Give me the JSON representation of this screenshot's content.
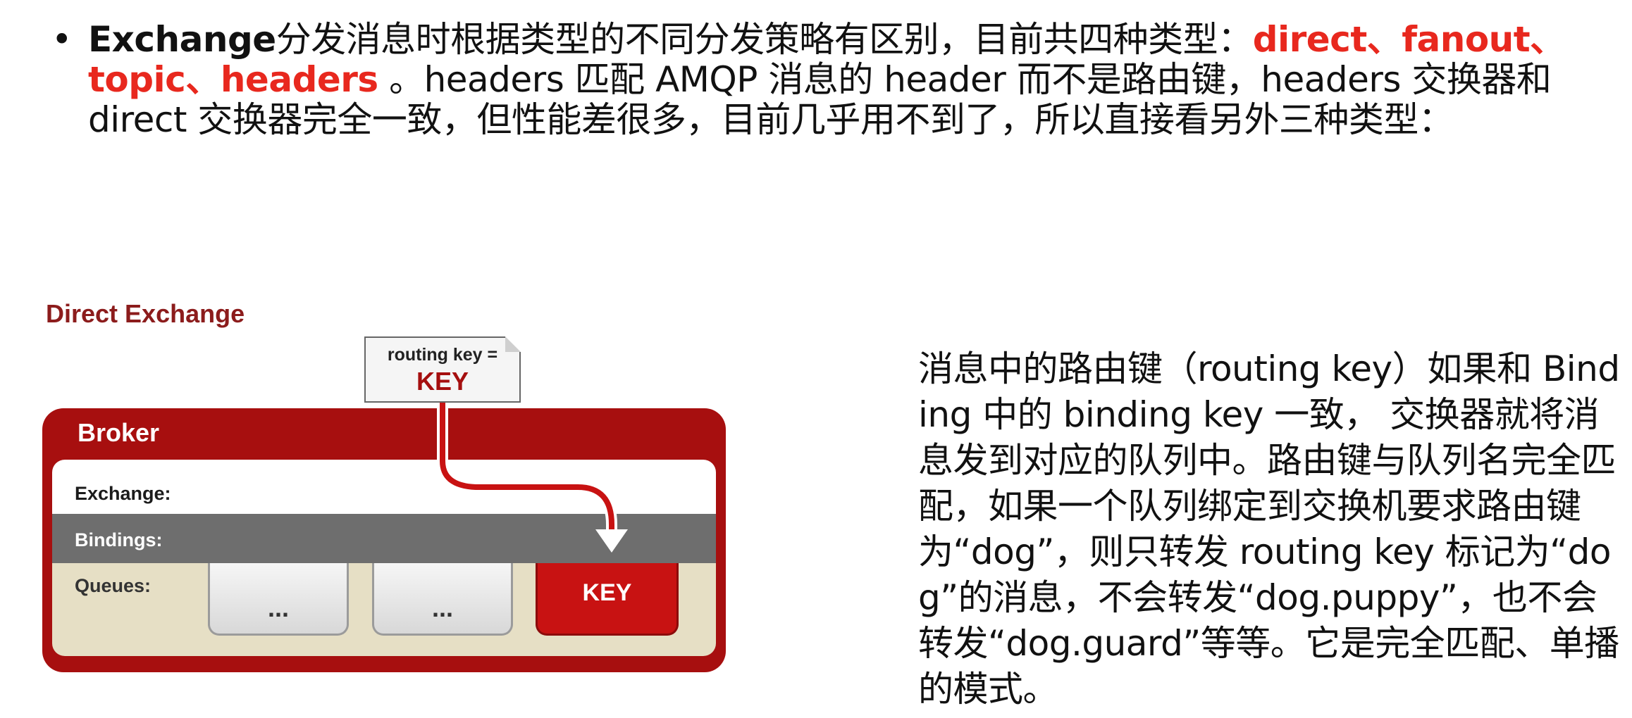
{
  "bullet": {
    "symbol": "•",
    "keyword": "Exchange",
    "lead_text": "分发消息时根据类型的不同分发策略有区别，目前共四种类型：",
    "types": "direct、fanout、topic、headers",
    "trail_text": " 。headers 匹配 AMQP 消息的 header 而不是路由键，headers 交换器和 direct 交换器完全一致，但性能差很多，目前几乎用不到了，所以直接看另外三种类型："
  },
  "diagram": {
    "title": "Direct Exchange",
    "message": {
      "routing_key_label": "routing key =",
      "key": "KEY"
    },
    "broker_label": "Broker",
    "rows": {
      "exchange": "Exchange:",
      "bindings": "Bindings:",
      "queues": "Queues:"
    },
    "queues": [
      "...",
      "...",
      "KEY"
    ],
    "colors": {
      "broker": "#a70f0f",
      "bindings_band": "#6e6e6e",
      "queues_band": "#e6dfc5",
      "highlight_queue": "#c81212",
      "route_line": "#c81212"
    }
  },
  "description": "消息中的路由键（routing key）如果和 Binding 中的 binding key 一致， 交换器就将消息发到对应的队列中。路由键与队列名完全匹配，如果一个队列绑定到交换机要求路由键为“dog”，则只转发 routing key 标记为“dog”的消息，不会转发“dog.puppy”，也不会转发“dog.guard”等等。它是完全匹配、单播的模式。"
}
